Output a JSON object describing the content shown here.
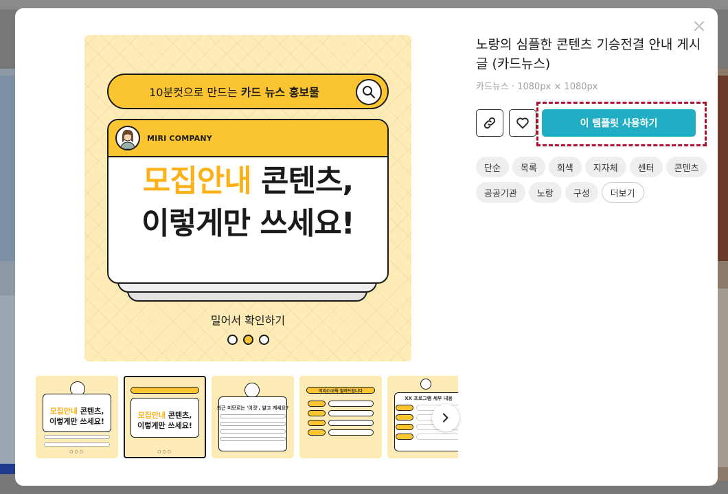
{
  "modal": {
    "close_icon": "close-icon"
  },
  "preview": {
    "search_text_pre": "10분컷으로 만드는 ",
    "search_text_bold": "카드 뉴스 홍보물",
    "company": "MIRI COMPANY",
    "headline_accent": "모집안내",
    "headline_rest": " 콘텐츠,",
    "headline_line2": "이렇게만 쓰세요!",
    "swipe_text": "밀어서 확인하기",
    "page_indicator": {
      "count": 3,
      "active_index": 1
    },
    "accent_color": "#fbc531",
    "background_color": "#fdecb8"
  },
  "thumbnails": [
    {
      "label_accent": "모집안내",
      "label_rest": " 콘텐츠,",
      "label_line2": "이렇게만 쓰세요!",
      "selected": false
    },
    {
      "label_accent": "모집안내",
      "label_rest": " 콘텐츠,",
      "label_line2": "이렇게만 쓰세요!",
      "selected": true
    },
    {
      "label_line1": "최근 미모르는 '이것', 알고 계세요?",
      "selected": false
    },
    {
      "label_line1": "미리CI교육 알려드립니다",
      "selected": false
    },
    {
      "label_line1": "XX 프로그램 세부 내용",
      "selected": false
    }
  ],
  "details": {
    "title": "노랑의 심플한 콘텐츠 기승전결 안내 게시글 (카드뉴스)",
    "meta": "카드뉴스 · 1080px × 1080px",
    "link_icon": "link-icon",
    "heart_icon": "heart-icon",
    "use_button": "이 템플릿 사용하기",
    "use_button_color": "#21aec5",
    "highlight_color": "#b01030",
    "tags": [
      "단순",
      "목록",
      "회색",
      "지자체",
      "센터",
      "콘텐츠",
      "공공기관",
      "노랑",
      "구성"
    ],
    "more_label": "더보기"
  }
}
